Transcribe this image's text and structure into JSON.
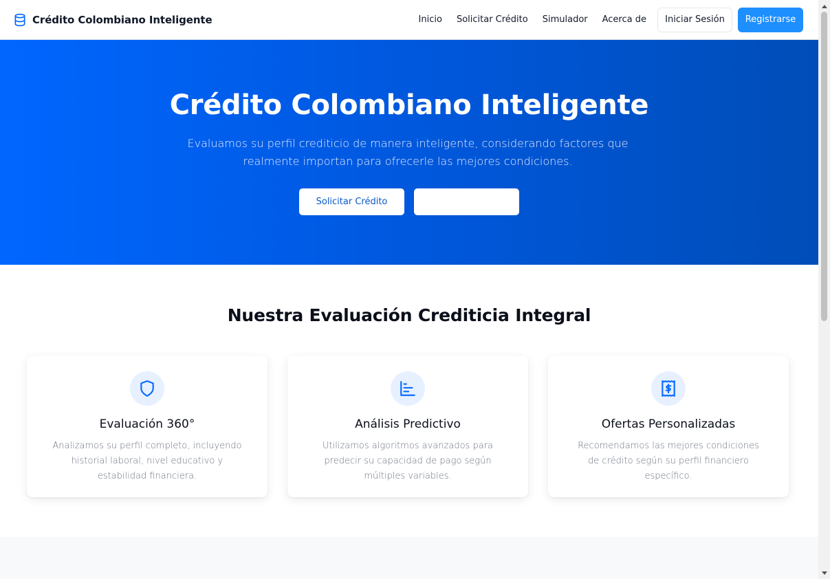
{
  "navbar": {
    "brand": "Crédito Colombiano Inteligente",
    "brand_icon": "database-icon",
    "links": [
      "Inicio",
      "Solicitar Crédito",
      "Simulador",
      "Acerca de"
    ],
    "login_label": "Iniciar Sesión",
    "register_label": "Registrarse"
  },
  "hero": {
    "title": "Crédito Colombiano Inteligente",
    "subtitle": "Evaluamos su perfil crediticio de manera inteligente, considerando factores que realmente importan para ofrecerle las mejores condiciones.",
    "primary_button": "Solicitar Crédito",
    "secondary_button": ""
  },
  "features": {
    "title": "Nuestra Evaluación Crediticia Integral",
    "cards": [
      {
        "icon": "shield-icon",
        "title": "Evaluación 360°",
        "description": "Analizamos su perfil completo, incluyendo historial laboral, nivel educativo y estabilidad financiera."
      },
      {
        "icon": "bar-chart-icon",
        "title": "Análisis Predictivo",
        "description": "Utilizamos algoritmos avanzados para predecir su capacidad de pago según múltiples variables."
      },
      {
        "icon": "receipt-icon",
        "title": "Ofertas Personalizadas",
        "description": "Recomendamos las mejores condiciones de crédito según su perfil financiero específico."
      }
    ]
  },
  "colors": {
    "primary": "#0066ff",
    "hero_gradient_end": "#004db8",
    "register_button": "#1e8fff",
    "icon_bg": "#e7f0ff"
  }
}
